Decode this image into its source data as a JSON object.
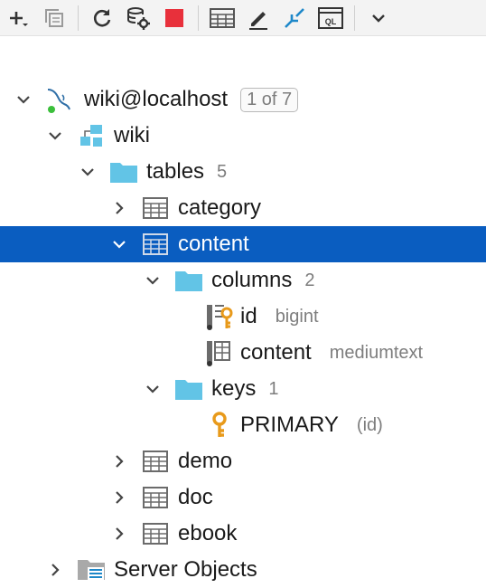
{
  "toolbar": {
    "buttons": [
      {
        "name": "add-icon"
      },
      {
        "name": "duplicate-icon"
      },
      {
        "name": "refresh-icon"
      },
      {
        "name": "database-settings-icon"
      },
      {
        "name": "stop-icon"
      },
      {
        "name": "table-view-icon"
      },
      {
        "name": "edit-icon"
      },
      {
        "name": "jump-to-source-icon"
      },
      {
        "name": "query-console-icon"
      },
      {
        "name": "more-icon"
      }
    ]
  },
  "tree": {
    "datasource": {
      "label": "wiki@localhost",
      "badge": "1 of 7"
    },
    "schema": {
      "label": "wiki"
    },
    "tables_folder": {
      "label": "tables",
      "count": "5"
    },
    "table_category": {
      "label": "category"
    },
    "table_content": {
      "label": "content"
    },
    "columns_folder": {
      "label": "columns",
      "count": "2"
    },
    "col_id": {
      "label": "id",
      "type": "bigint"
    },
    "col_content": {
      "label": "content",
      "type": "mediumtext"
    },
    "keys_folder": {
      "label": "keys",
      "count": "1"
    },
    "key_primary": {
      "label": "PRIMARY",
      "detail": "(id)"
    },
    "table_demo": {
      "label": "demo"
    },
    "table_doc": {
      "label": "doc"
    },
    "table_ebook": {
      "label": "ebook"
    },
    "server_objects": {
      "label": "Server Objects"
    }
  },
  "colors": {
    "selection": "#0a5dc0",
    "folder": "#62c4e6",
    "key": "#e89a1b",
    "stop": "#e8303b",
    "accent_blue": "#1e88c9"
  }
}
